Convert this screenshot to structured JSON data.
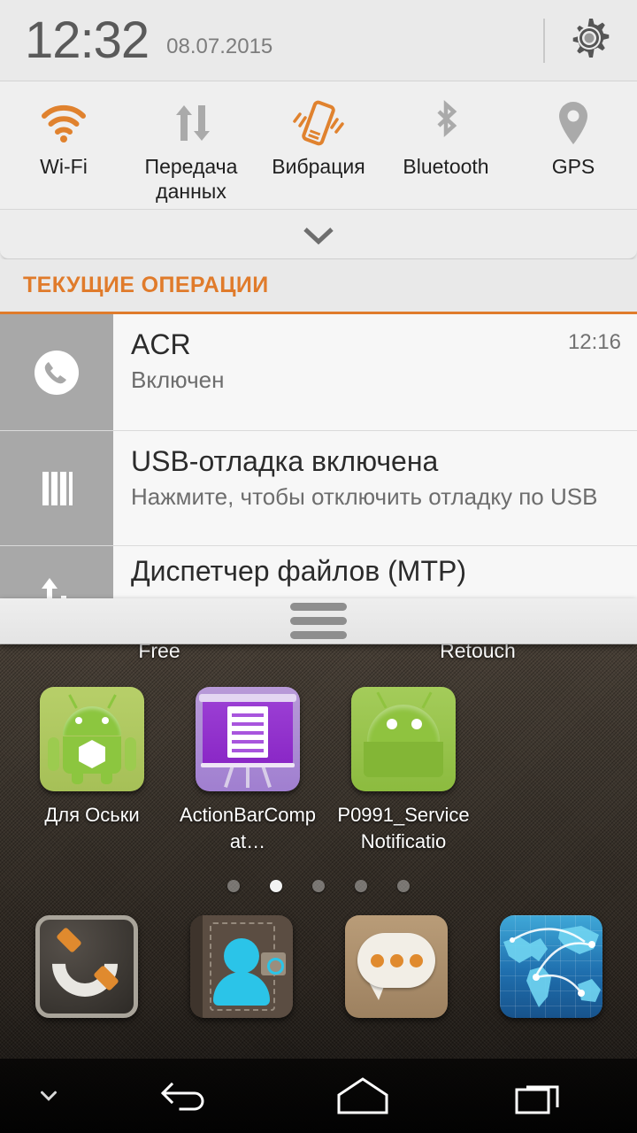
{
  "status": {
    "time": "12:32",
    "date": "08.07.2015",
    "settings_icon": "gear-icon"
  },
  "quick_toggles": [
    {
      "label": "Wi-Fi",
      "icon": "wifi-icon",
      "state": "on",
      "color": "#e0822e"
    },
    {
      "label": "Передача данных",
      "icon": "data-transfer-icon",
      "state": "off",
      "color": "#aaaaaa"
    },
    {
      "label": "Вибрация",
      "icon": "vibration-icon",
      "state": "on",
      "color": "#e0822e"
    },
    {
      "label": "Bluetooth",
      "icon": "bluetooth-icon",
      "state": "off",
      "color": "#aaaaaa"
    },
    {
      "label": "GPS",
      "icon": "gps-pin-icon",
      "state": "off",
      "color": "#aaaaaa"
    }
  ],
  "expand_handle": {
    "icon": "chevron-down-icon"
  },
  "section": {
    "title": "ТЕКУЩИЕ ОПЕРАЦИИ",
    "accent_color": "#e07b2b"
  },
  "notifications": [
    {
      "icon": "phone-call-icon",
      "title": "ACR",
      "subtitle": "Включен",
      "time": "12:16"
    },
    {
      "icon": "usb-debug-icon",
      "title": "USB-отладка включена",
      "subtitle": "Нажмите, чтобы отключить отладку по USB",
      "time": ""
    },
    {
      "icon": "mtp-transfer-icon",
      "title": "Диспетчер файлов (MTP)",
      "subtitle": "",
      "time": ""
    }
  ],
  "drag_handle": {
    "name": "shade-drag-handle"
  },
  "homescreen": {
    "clipped_labels": [
      "Free",
      "Retouch"
    ],
    "apps": [
      {
        "label": "Для Оськи",
        "icon": "android-box-app-icon"
      },
      {
        "label": "ActionBarCompat…",
        "icon": "presentation-board-app-icon"
      },
      {
        "label": "P0991_ServiceNotificatio",
        "icon": "android-head-app-icon"
      }
    ],
    "page_dots": {
      "count": 5,
      "active_index": 1
    },
    "dock": [
      {
        "icon": "phone-dialer-icon",
        "label": ""
      },
      {
        "icon": "contacts-book-icon",
        "label": ""
      },
      {
        "icon": "messaging-icon",
        "label": ""
      },
      {
        "icon": "browser-globe-icon",
        "label": ""
      }
    ]
  },
  "navbar": {
    "hide_icon": "chevron-down-icon",
    "back_icon": "back-arrow-icon",
    "home_icon": "home-icon",
    "recents_icon": "recent-apps-icon"
  }
}
